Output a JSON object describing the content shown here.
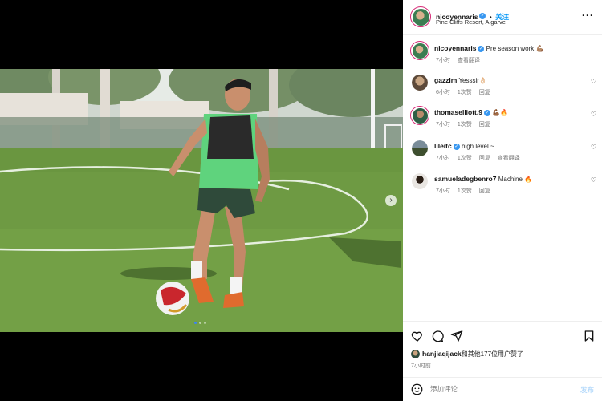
{
  "post": {
    "username": "nicoyennaris",
    "follow_label": "关注",
    "location": "Pine Cliffs Resort, Algarve",
    "more_label": "···"
  },
  "caption": {
    "username": "nicoyennaris",
    "text": "Pre season work 💪🏽",
    "time": "7小时",
    "translate": "查看翻译"
  },
  "comments": [
    {
      "username": "gazzlm",
      "text": "Yesssir👌🏻",
      "time": "6小时",
      "likes": "1次赞",
      "reply": "回复",
      "translate": "",
      "verified": false
    },
    {
      "username": "thomaselliott.9",
      "text": "💪🏾🔥",
      "time": "7小时",
      "likes": "1次赞",
      "reply": "回复",
      "translate": "",
      "verified": true
    },
    {
      "username": "lileitc",
      "text": "high level ~",
      "time": "7小时",
      "likes": "1次赞",
      "reply": "回复",
      "translate": "查看翻译",
      "verified": true
    },
    {
      "username": "samueladegbenro7",
      "text": "Machine 🔥",
      "time": "7小时",
      "likes": "1次赞",
      "reply": "回复",
      "translate": "",
      "verified": false
    }
  ],
  "likes_summary": {
    "user": "hanjiaqijack",
    "text": "和其他177位用户赞了"
  },
  "post_time": "7小时前",
  "add_comment": {
    "placeholder": "添加评论...",
    "post_label": "发布"
  },
  "carousel": {
    "slide_count": 3,
    "active_index": 0
  },
  "colors": {
    "accent": "#0095f6",
    "verified": "#3897f0"
  }
}
